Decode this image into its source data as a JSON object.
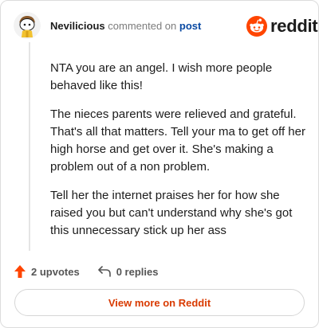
{
  "header": {
    "username": "Nevilicious",
    "action_text": "commented on",
    "post_link": "post",
    "brand": "reddit"
  },
  "comment": {
    "paragraphs": [
      "NTA you are an angel. I wish more people behaved like this!",
      "The nieces parents were relieved and grateful. That's all that matters. Tell your ma to get off her high horse and get over it. She's making a problem out of a non problem.",
      "Tell her the internet praises her for how she raised you but can't understand why she's got this unnecessary stick up her ass"
    ]
  },
  "actions": {
    "upvotes": "2 upvotes",
    "replies": "0 replies"
  },
  "footer": {
    "view_more": "View more on Reddit"
  },
  "colors": {
    "brand_orange": "#ff4500",
    "link_blue": "#0a4aa3",
    "cta_text": "#d93a00"
  },
  "icons": {
    "avatar": "snoo-avatar-icon",
    "brand": "reddit-snoo-icon",
    "upvote": "upvote-arrow-icon",
    "reply": "reply-arrow-icon"
  }
}
